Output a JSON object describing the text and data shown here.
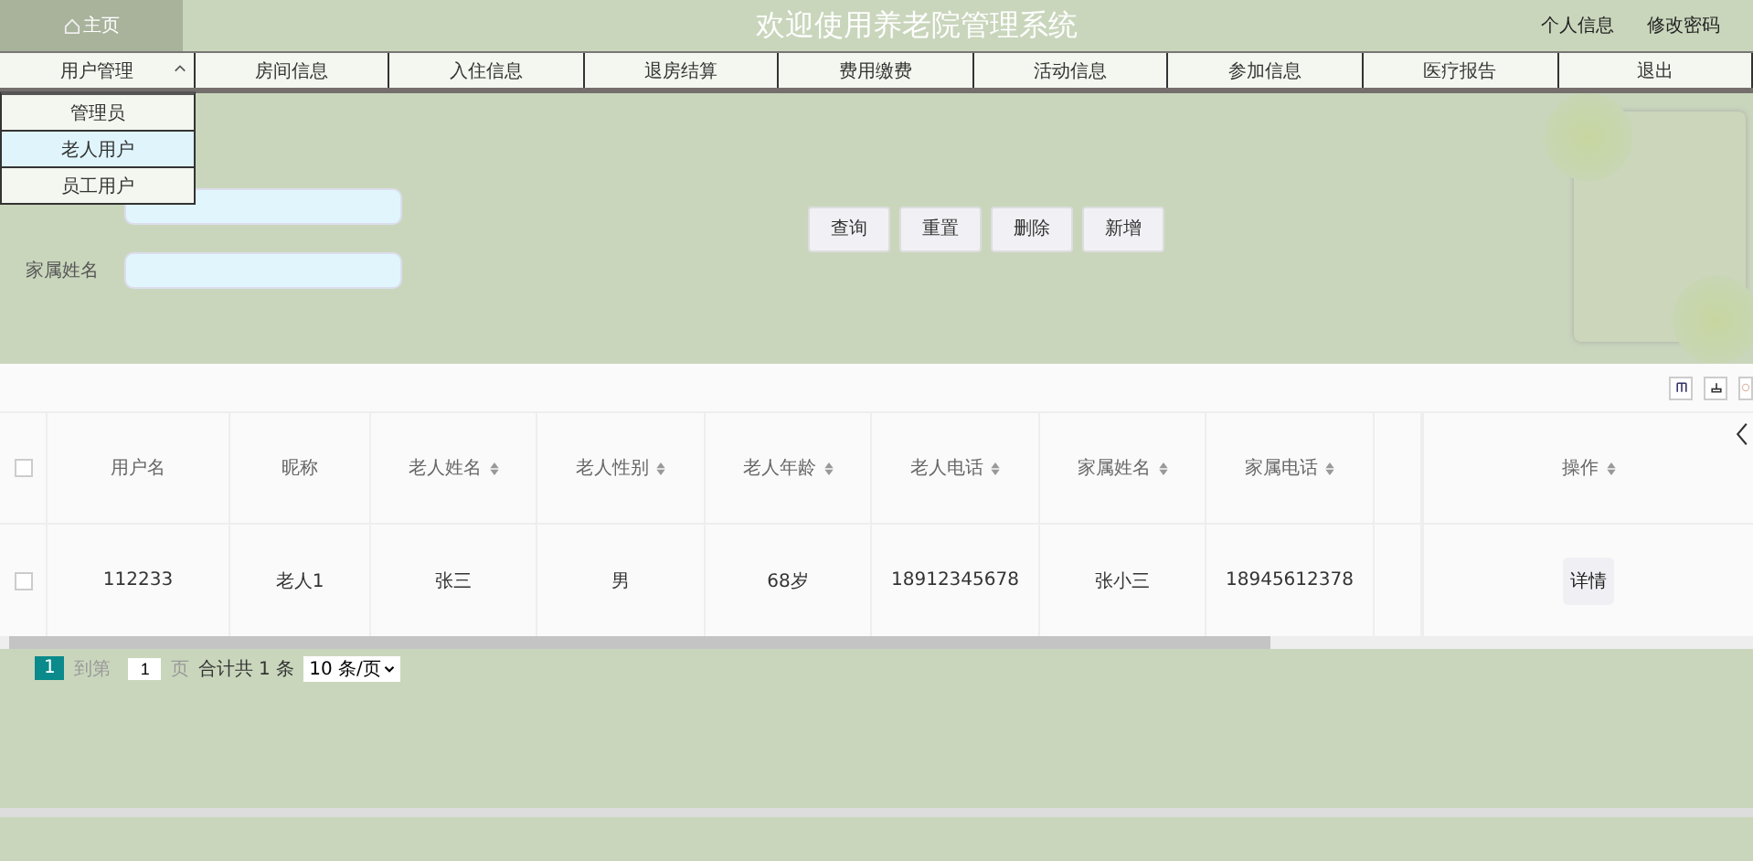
{
  "header": {
    "home": "主页",
    "title": "欢迎使用养老院管理系统",
    "links": [
      "个人信息",
      "修改密码"
    ]
  },
  "nav": [
    {
      "label": "用户管理",
      "expanded": true
    },
    {
      "label": "房间信息",
      "expanded": false
    },
    {
      "label": "入住信息",
      "expanded": false
    },
    {
      "label": "退房结算",
      "expanded": false
    },
    {
      "label": "费用缴费",
      "expanded": false
    },
    {
      "label": "活动信息",
      "expanded": false
    },
    {
      "label": "参加信息",
      "expanded": false
    },
    {
      "label": "医疗报告",
      "expanded": false
    },
    {
      "label": "退出",
      "expanded": false
    }
  ],
  "dropdown": [
    {
      "label": "管理员",
      "selected": false
    },
    {
      "label": "老人用户",
      "selected": true
    },
    {
      "label": "员工用户",
      "selected": false
    }
  ],
  "search": {
    "fields": [
      {
        "label": "家属姓名"
      }
    ],
    "buttons": [
      "查询",
      "重置",
      "删除",
      "新增"
    ]
  },
  "table": {
    "columns": [
      {
        "label": "用户名",
        "sortable": false
      },
      {
        "label": "昵称",
        "sortable": false
      },
      {
        "label": "老人姓名",
        "sortable": true
      },
      {
        "label": "老人性别",
        "sortable": true
      },
      {
        "label": "老人年龄",
        "sortable": true
      },
      {
        "label": "老人电话",
        "sortable": true
      },
      {
        "label": "家属姓名",
        "sortable": true
      },
      {
        "label": "家属电话",
        "sortable": true
      },
      {
        "label": "操作",
        "sortable": true
      }
    ],
    "all_checked": false,
    "rows": [
      {
        "checked": false,
        "cells": [
          "112233",
          "老人1",
          "张三",
          "男",
          "68岁",
          "18912345678",
          "张小三",
          "18945612378"
        ],
        "action": "详情"
      }
    ]
  },
  "pager": {
    "current": "1",
    "goto_label": "到第",
    "page_value": "1",
    "page_unit": "页",
    "total": "合计共 1 条",
    "page_size": "10 条/页"
  }
}
